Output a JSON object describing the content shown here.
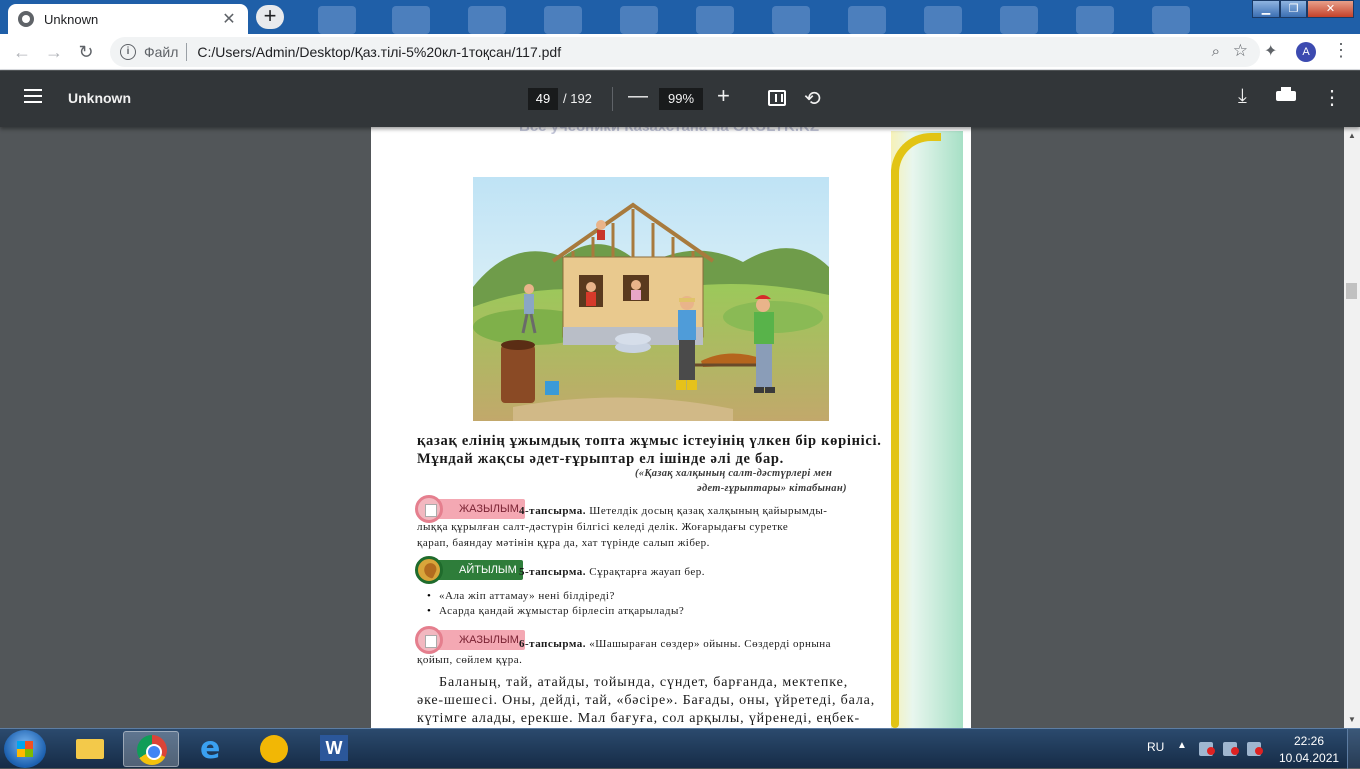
{
  "browser": {
    "tab_title": "Unknown",
    "tab_close": "✕",
    "new_tab": "+",
    "address_scheme": "Файл",
    "address_url": "C:/Users/Admin/Desktop/Қаз.тілі-5%20кл-1тоқсан/117.pdf",
    "profile_initial": "A"
  },
  "pdf_toolbar": {
    "title": "Unknown",
    "current_page": "49",
    "total_pages": "/ 192",
    "zoom": "99%"
  },
  "document": {
    "watermark": "Все учебники Казахстана на OKULYK.KZ",
    "line1": "қазақ елінің ұжымдық топта жұмыс істеуінің үлкен бір көрінісі.",
    "line2": "Мұндай жақсы әдет-ғұрыптар  ел ішінде әлі де бар.",
    "source1": "(«Қазақ халқының салт-дәстүрлері мен",
    "source2": "әдет-ғұрыптары» кітабынан)",
    "badge_write": "ЖАЗЫЛЫМ",
    "badge_speak": "АЙТЫЛЫМ",
    "task4_label": "4-тапсырма.",
    "task4_line1": " Шетелдік досың қазақ халқының қайырымды-",
    "task4_line2": "лыққа құрылған салт-дәстүрін білгісі келеді делік. Жоғарыдағы суретке",
    "task4_line3": "қарап, баяндау мәтінін құра да, хат түрінде салып жібер.",
    "task5_label": "5-тапсырма.",
    "task5_text": " Сұрақтарға жауап бер.",
    "bullet": "•",
    "q1": "«Ала жіп аттамау» нені білдіреді?",
    "q2": "Асарда қандай жұмыстар бірлесіп атқарылады?",
    "task6_label": "6-тапсырма.",
    "task6_line1": " «Шашыраған сөздер» ойыны. Сөздерді орнына",
    "task6_line2": "қойып, сөйлем құра.",
    "para1": "Баланың, тай, атайды, тойында, сүндет, барғанда, мектепке,",
    "para2": "әке-шешесі. Оны, дейді, тай, «бәсіре». Бағады, оны, үйретеді, бала,",
    "para3": "күтімге алады, ерекше. Мал бағуға, сол арқылы, үйренеді, еңбек-"
  },
  "taskbar": {
    "lang": "RU",
    "time": "22:26",
    "date": "10.04.2021"
  }
}
